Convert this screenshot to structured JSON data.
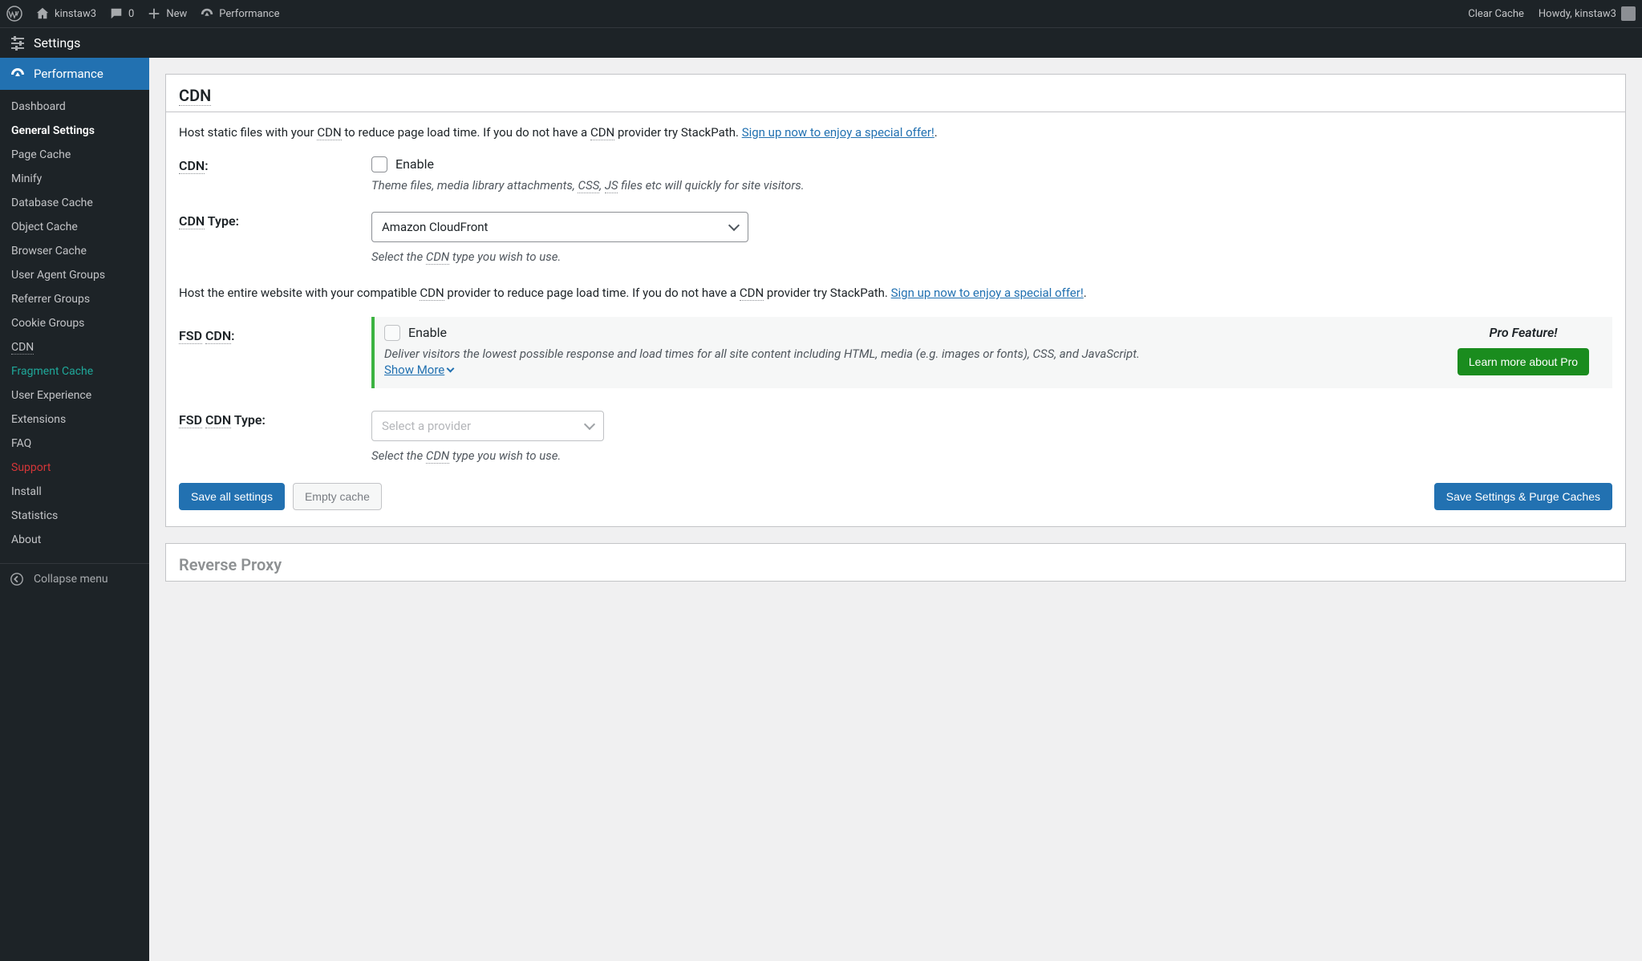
{
  "adminbar": {
    "site_name": "kinstaw3",
    "comments_count": "0",
    "new_label": "New",
    "perf_label": "Performance",
    "clear_cache": "Clear Cache",
    "howdy": "Howdy, kinstaw3"
  },
  "secondbar": {
    "title": "Settings"
  },
  "sidebar": {
    "top": "Performance",
    "items": [
      {
        "label": "Dashboard"
      },
      {
        "label": "General Settings",
        "current": true
      },
      {
        "label": "Page Cache"
      },
      {
        "label": "Minify"
      },
      {
        "label": "Database Cache"
      },
      {
        "label": "Object Cache"
      },
      {
        "label": "Browser Cache"
      },
      {
        "label": "User Agent Groups"
      },
      {
        "label": "Referrer Groups"
      },
      {
        "label": "Cookie Groups"
      },
      {
        "label": "CDN",
        "dotted": true
      },
      {
        "label": "Fragment Cache",
        "frag": true
      },
      {
        "label": "User Experience"
      },
      {
        "label": "Extensions"
      },
      {
        "label": "FAQ"
      },
      {
        "label": "Support",
        "sup": true
      },
      {
        "label": "Install"
      },
      {
        "label": "Statistics"
      },
      {
        "label": "About"
      }
    ],
    "collapse": "Collapse menu"
  },
  "cdn": {
    "heading": "CDN",
    "intro_1": "Host static files with your ",
    "intro_cdn": "CDN",
    "intro_2": " to reduce page load time. If you do not have a ",
    "intro_3": " provider try StackPath. ",
    "signup": "Sign up now to enjoy a special offer!",
    "label_cdn": "CDN",
    "label_cdn_colon": ":",
    "enable": "Enable",
    "desc_a": "Theme files, media library attachments, ",
    "desc_css": "CSS",
    "desc_b": ", ",
    "desc_js": "JS",
    "desc_c": " files etc will quickly for site visitors.",
    "type_label_1": "CDN",
    "type_label_2": " Type:",
    "select_value": "Amazon CloudFront",
    "type_desc_1": "Select the ",
    "type_desc_2": " type you wish to use.",
    "full_intro_1": "Host the entire website with your compatible ",
    "full_intro_2": " provider to reduce page load time. If you do not have a ",
    "full_intro_3": " provider try StackPath. ",
    "fsd_label_1": "FSD",
    "fsd_label_2": "CDN",
    "fsd_label_3": ":",
    "pro_title": "Pro Feature!",
    "pro_btn": "Learn more about Pro",
    "fsd_desc": "Deliver visitors the lowest possible response and load times for all site content including HTML, media (e.g. images or fonts), CSS, and JavaScript.",
    "show_more": "Show More",
    "fsd_type_1": "FSD",
    "fsd_type_2": "CDN",
    "fsd_type_3": " Type:",
    "fsd_select_placeholder": "Select a provider",
    "save_all": "Save all settings",
    "empty_cache": "Empty cache",
    "save_purge": "Save Settings & Purge Caches"
  },
  "next_panel": {
    "heading": "Reverse Proxy"
  }
}
